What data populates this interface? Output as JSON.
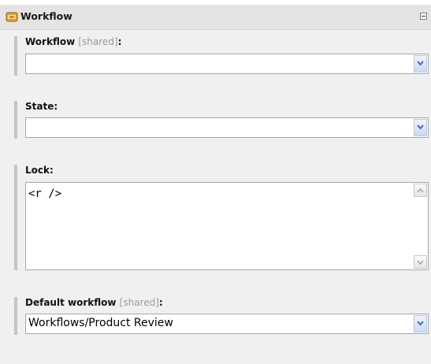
{
  "panel": {
    "title": "Workflow",
    "icon": "workflow-icon",
    "collapse_icon": "collapse-icon"
  },
  "fields": {
    "workflow": {
      "label": "Workflow",
      "shared": "[shared]",
      "colon": ":",
      "value": ""
    },
    "state": {
      "label": "State:",
      "value": ""
    },
    "lock": {
      "label": "Lock:",
      "value": "<r />"
    },
    "default_workflow": {
      "label": "Default workflow",
      "shared": "[shared]",
      "colon": ":",
      "value": "Workflows/Product Review"
    }
  },
  "colors": {
    "panel_bg": "#f0f0f0",
    "header_bg": "#e4e4e4",
    "field_bar": "#c4c4c4",
    "dropdown_arrow": "#3d6fb8"
  }
}
